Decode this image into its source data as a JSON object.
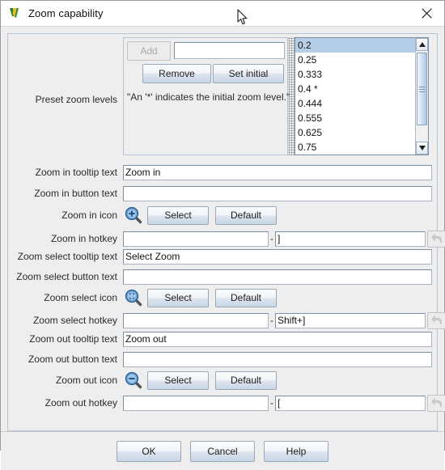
{
  "window": {
    "title": "Zoom capability",
    "icon": "app-logo-icon",
    "close_icon": "close-icon"
  },
  "preset": {
    "label": "Preset zoom levels",
    "add_label": "Add",
    "add_field_value": "",
    "remove_label": "Remove",
    "set_initial_label": "Set initial",
    "hint": "\"An '*' indicates the initial zoom level.\"",
    "levels": [
      "0.2",
      "0.25",
      "0.333",
      "0.4 *",
      "0.444",
      "0.555",
      "0.625",
      "0.75"
    ],
    "selected_index": 0
  },
  "rows": {
    "zoom_in_tooltip": {
      "label": "Zoom in tooltip text",
      "value": "Zoom in"
    },
    "zoom_in_button": {
      "label": "Zoom in button text",
      "value": ""
    },
    "zoom_in_icon": {
      "label": "Zoom in icon",
      "icon": "zoom-in-magnifier-icon",
      "select_label": "Select",
      "default_label": "Default"
    },
    "zoom_in_hotkey": {
      "label": "Zoom in hotkey",
      "modifier": "",
      "separator": "-",
      "key": "]",
      "undo_icon": "undo-arrow-icon"
    },
    "zoom_select_tooltip": {
      "label": "Zoom select tooltip text",
      "value": "Select Zoom"
    },
    "zoom_select_button": {
      "label": "Zoom select button text",
      "value": ""
    },
    "zoom_select_icon": {
      "label": "Zoom select icon",
      "icon": "zoom-select-magnifier-icon",
      "select_label": "Select",
      "default_label": "Default"
    },
    "zoom_select_hotkey": {
      "label": "Zoom select hotkey",
      "modifier": "",
      "separator": "-",
      "key": "Shift+]",
      "undo_icon": "undo-arrow-icon"
    },
    "zoom_out_tooltip": {
      "label": "Zoom out tooltip text",
      "value": "Zoom out"
    },
    "zoom_out_button": {
      "label": "Zoom out button text",
      "value": ""
    },
    "zoom_out_icon": {
      "label": "Zoom out icon",
      "icon": "zoom-out-magnifier-icon",
      "select_label": "Select",
      "default_label": "Default"
    },
    "zoom_out_hotkey": {
      "label": "Zoom out hotkey",
      "modifier": "",
      "separator": "-",
      "key": "[",
      "undo_icon": "undo-arrow-icon"
    }
  },
  "footer": {
    "ok_label": "OK",
    "cancel_label": "Cancel",
    "help_label": "Help"
  },
  "colors": {
    "panel_bg": "#eeeeee",
    "field_bg": "#ffffff",
    "selection": "#b6cfe8",
    "border": "#b6c4d6",
    "button_face": "#dde5ef"
  }
}
